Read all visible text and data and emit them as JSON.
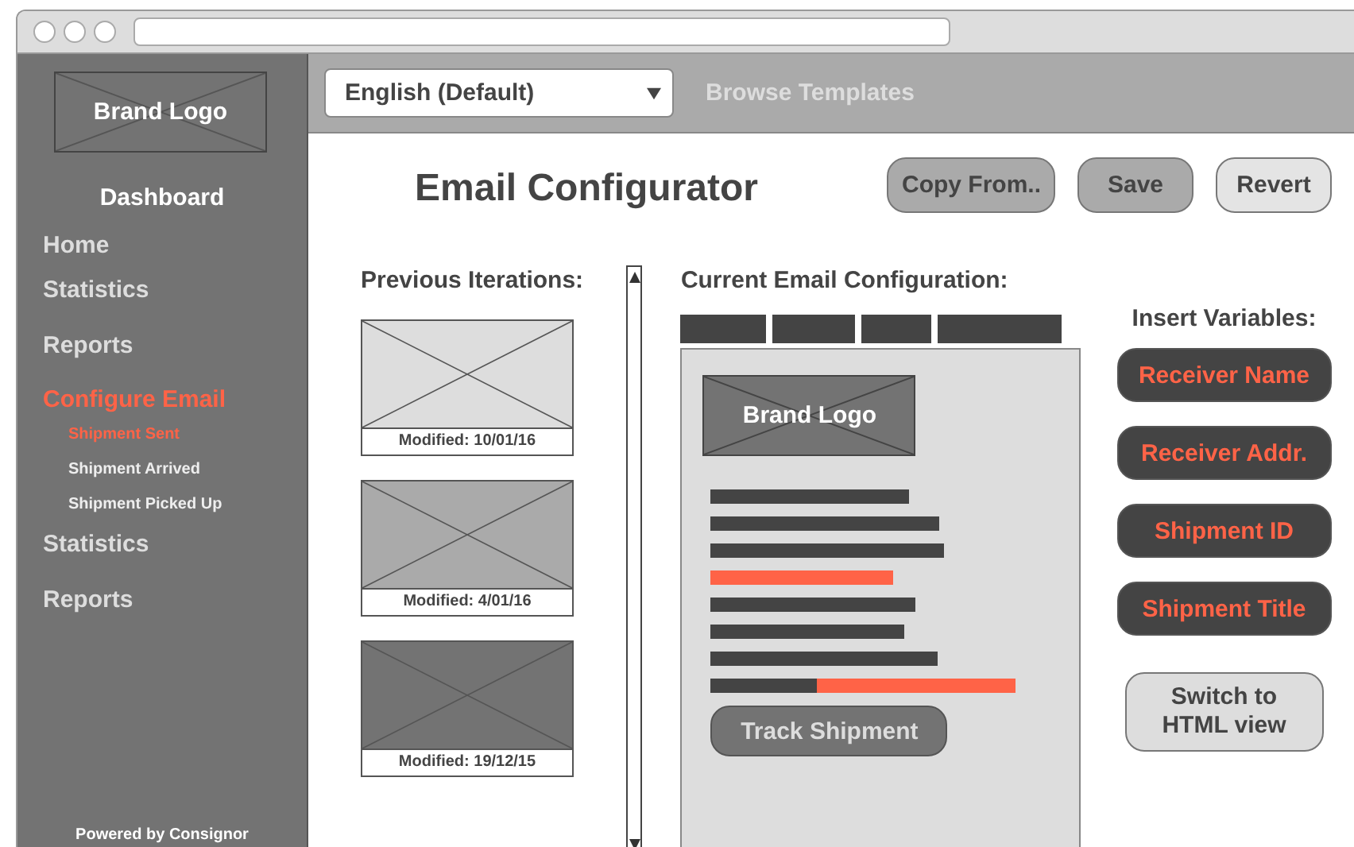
{
  "sidebar": {
    "logo": "Brand Logo",
    "heading": "Dashboard",
    "items": [
      {
        "label": "Home",
        "selected": false
      },
      {
        "label": "Statistics",
        "selected": false
      },
      {
        "label": "Reports",
        "selected": false
      },
      {
        "label": "Configure Email",
        "selected": true,
        "children": [
          {
            "label": "Shipment Sent",
            "selected": true
          },
          {
            "label": "Shipment Arrived",
            "selected": false
          },
          {
            "label": "Shipment Picked Up",
            "selected": false
          }
        ]
      },
      {
        "label": "Statistics",
        "selected": false
      },
      {
        "label": "Reports",
        "selected": false
      }
    ],
    "footer": "Powered by Consignor"
  },
  "toolbar": {
    "language_select": {
      "value": "English (Default)"
    },
    "link": "Browse Templates"
  },
  "title": "Email Configurator",
  "buttons": [
    {
      "label": "Copy From..",
      "kind": "medium"
    },
    {
      "label": "Save",
      "kind": "medium"
    },
    {
      "label": "Revert",
      "kind": "light"
    }
  ],
  "previous_iterations": {
    "title": "Previous Iterations:",
    "items": [
      {
        "caption": "Modified: 10/01/16",
        "color": "#dddddd"
      },
      {
        "caption": "Modified: 4/01/16",
        "color": "#aaaaaa"
      },
      {
        "caption": "Modified: 19/12/15",
        "color": "#737373"
      }
    ]
  },
  "current_configuration": {
    "title": "Current Email Configuration:",
    "preview": {
      "logo": "Brand Logo",
      "button": "Track Shipment"
    }
  },
  "insert_variables": {
    "title": "Insert Variables:",
    "items": [
      "Receiver Name",
      "Receiver Addr.",
      "Shipment ID",
      "Shipment Title"
    ],
    "switch_button": "Switch to HTML view"
  }
}
